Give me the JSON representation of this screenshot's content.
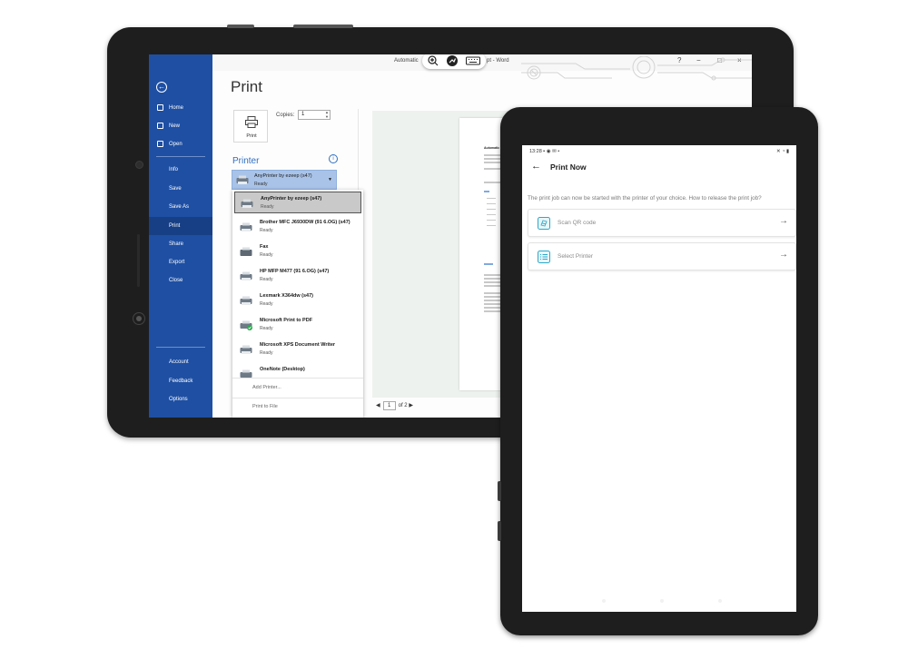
{
  "word": {
    "sidebar": {
      "items": [
        {
          "label": "Home"
        },
        {
          "label": "New"
        },
        {
          "label": "Open"
        },
        {
          "label": "Info"
        },
        {
          "label": "Save"
        },
        {
          "label": "Save As"
        },
        {
          "label": "Print"
        },
        {
          "label": "Share"
        },
        {
          "label": "Export"
        },
        {
          "label": "Close"
        }
      ],
      "bottom_items": [
        {
          "label": "Account"
        },
        {
          "label": "Feedback"
        },
        {
          "label": "Options"
        }
      ]
    },
    "titlebar": {
      "doc_text": "Automatic",
      "app_text": "pt - Word",
      "help": "?",
      "minimize": "−",
      "maximize": "□",
      "close": "×"
    },
    "print": {
      "title": "Print",
      "print_button_label": "Print",
      "copies_label": "Copies:",
      "copies_value": "1",
      "printer_label": "Printer",
      "info_glyph": "i",
      "selected": {
        "name": "AnyPrinter by ezeep (s47)",
        "status": "Ready"
      },
      "printers": [
        {
          "name": "AnyPrinter by ezeep (s47)",
          "status": "Ready"
        },
        {
          "name": "Brother MFC J6930DW (91 6.OG) (s47)",
          "status": "Ready"
        },
        {
          "name": "Fax",
          "status": "Ready"
        },
        {
          "name": "HP MFP M477 (91 6.OG) (s47)",
          "status": "Ready"
        },
        {
          "name": "Lexmark X364dw (s47)",
          "status": "Ready"
        },
        {
          "name": "Microsoft Print to PDF",
          "status": "Ready"
        },
        {
          "name": "Microsoft XPS Document Writer",
          "status": "Ready"
        },
        {
          "name": "OneNote (Desktop)",
          "status": ""
        }
      ],
      "add_printer": "Add Printer...",
      "print_to_file": "Print to File",
      "pager": {
        "current": "1",
        "of": "of 2"
      },
      "preview_heading": "Automatic"
    }
  },
  "phone": {
    "status_time": "13:28",
    "app_title": "Print Now",
    "instructions": "The print job can now be started with the printer of your choice. How to release the print job?",
    "options": [
      {
        "label": "Scan QR code",
        "icon": "qr-icon"
      },
      {
        "label": "Select Printer",
        "icon": "printer-list-icon"
      }
    ],
    "accent_color": "#2ca9c9"
  }
}
